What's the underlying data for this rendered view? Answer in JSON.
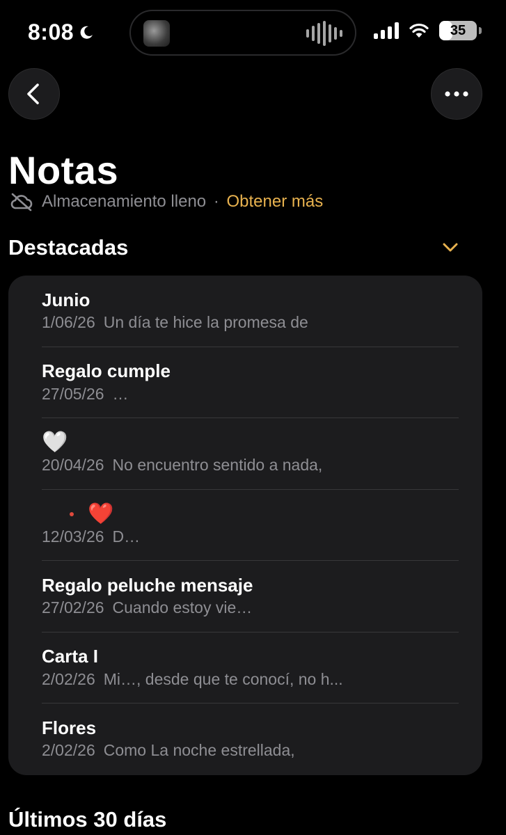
{
  "status_bar": {
    "time": "8:08",
    "battery": "35",
    "battery_fraction": 0.35,
    "icons": [
      "moon-icon",
      "signal-icon",
      "wifi-icon",
      "battery-icon"
    ]
  },
  "nav": {
    "back_icon": "chevron-left-icon",
    "more_icon": "ellipsis-icon"
  },
  "page": {
    "title": "Notas",
    "storage_text": "Almacenamiento lleno",
    "storage_separator": "·",
    "storage_link": "Obtener más"
  },
  "sections": {
    "featured": "Destacadas",
    "recent": "Últimos 30 días"
  },
  "colors": {
    "accent": "#e8b24f",
    "background": "#000000",
    "card": "#1c1c1e",
    "secondary_text": "#8e8e93"
  },
  "notes": [
    {
      "title": "Junio",
      "date": "1/06/26",
      "preview": "Un día te hice la promesa de"
    },
    {
      "title": "Regalo cumple",
      "date": "27/05/26",
      "preview": "…"
    },
    {
      "title": "🤍",
      "date": "20/04/26",
      "preview": "No encuentro sentido a nada,"
    },
    {
      "title": "❤️",
      "date": "12/03/26",
      "preview": "D…"
    },
    {
      "title": "Regalo peluche mensaje",
      "date": "27/02/26",
      "preview": "Cuando estoy vie…"
    },
    {
      "title": "Carta I",
      "date": "2/02/26",
      "preview": "Mi…, desde que te conocí, no h..."
    },
    {
      "title": "Flores",
      "date": "2/02/26",
      "preview": "Como La noche estrellada,"
    }
  ]
}
